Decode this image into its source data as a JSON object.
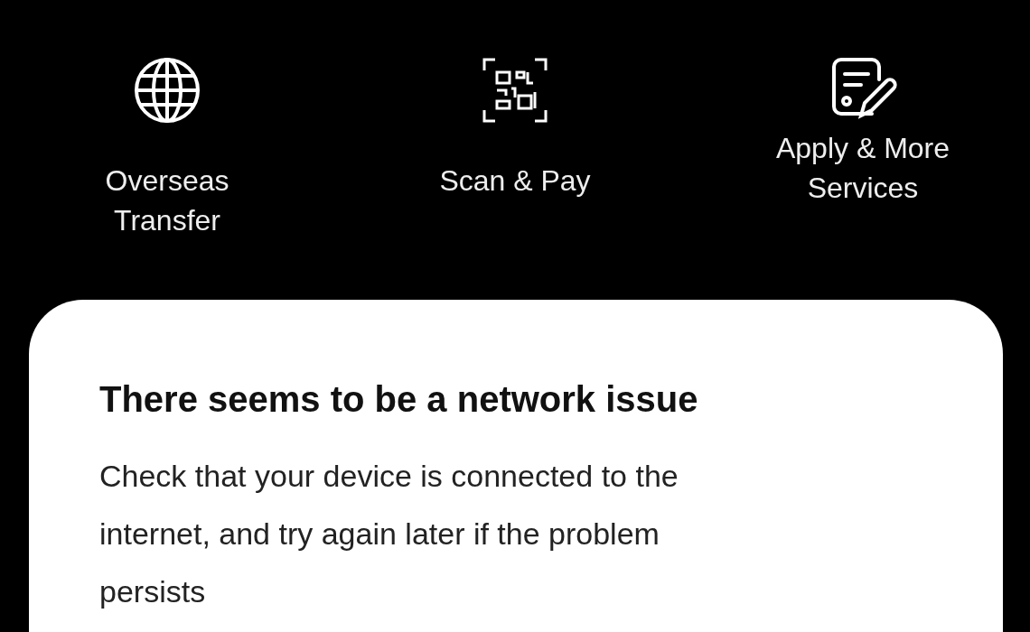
{
  "shortcuts": [
    {
      "kind": "globe",
      "label": "Overseas Transfer"
    },
    {
      "kind": "scan",
      "label": "Scan & Pay"
    },
    {
      "kind": "form",
      "label": "Apply & More Services"
    }
  ],
  "notice": {
    "title": "There seems to be a network issue",
    "message": "Check that your device is connected to the internet, and try again later if the problem persists"
  }
}
